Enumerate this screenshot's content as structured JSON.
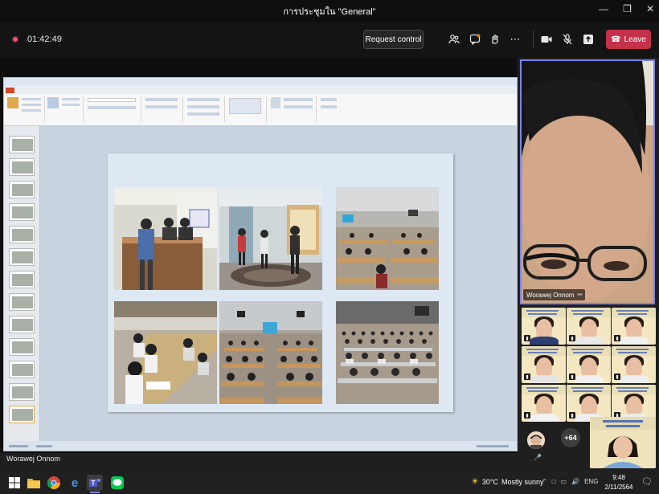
{
  "window": {
    "title": "การประชุมใน \"General\""
  },
  "toolbar": {
    "timer": "01:42:49",
    "request_control_label": "Request control",
    "leave_label": "Leave"
  },
  "presenter": {
    "name": "Worawej Onnom"
  },
  "participants": {
    "overflow_count": "+64"
  },
  "taskbar": {
    "temperature": "30°C",
    "condition": "Mostly sunny",
    "language": "ENG",
    "time": "9:48",
    "date": "2/11/2564"
  },
  "colors": {
    "leave": "#c4314b",
    "accent": "#7b83eb",
    "ppt_file_tab": "#d24726"
  }
}
